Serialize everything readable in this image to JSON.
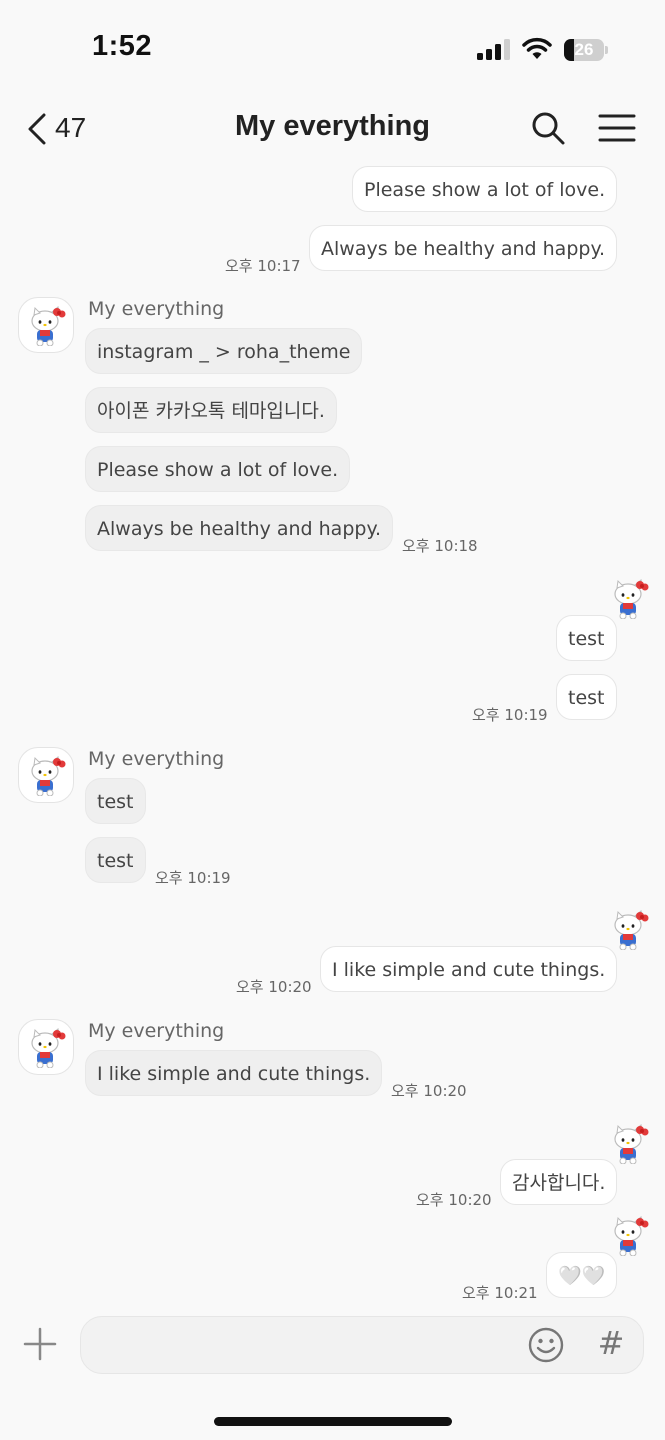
{
  "status_bar": {
    "time": "1:52",
    "battery": "26",
    "icons": [
      "cellular-signal-icon",
      "wifi-icon",
      "battery-icon"
    ]
  },
  "header": {
    "back_count": "47",
    "title": "My everything",
    "icons": [
      "chevron-left-icon",
      "search-icon",
      "menu-icon"
    ]
  },
  "messages": [
    {
      "from": "me",
      "text": "Please show a lot of love."
    },
    {
      "from": "me",
      "text": "Always be healthy and happy.",
      "time": "오후 10:17"
    },
    {
      "from": "them",
      "sender": "My everything",
      "text": "instagram _ > roha_theme"
    },
    {
      "from": "them",
      "text": "아이폰 카카오톡 테마입니다."
    },
    {
      "from": "them",
      "text": "Please show a lot of love."
    },
    {
      "from": "them",
      "text": "Always be healthy and happy.",
      "time": "오후 10:18"
    },
    {
      "from": "me",
      "text": "test"
    },
    {
      "from": "me",
      "text": "test",
      "time": "오후 10:19"
    },
    {
      "from": "them",
      "sender": "My everything",
      "text": "test"
    },
    {
      "from": "them",
      "text": "test",
      "time": "오후 10:19"
    },
    {
      "from": "me",
      "text": "I like simple and cute things.",
      "time": "오후 10:20"
    },
    {
      "from": "them",
      "sender": "My everything",
      "text": "I like simple and cute things.",
      "time": "오후 10:20"
    },
    {
      "from": "me",
      "text": "감사합니다.",
      "time": "오후 10:20"
    },
    {
      "from": "me",
      "text": "🤍🤍",
      "time": "오후 10:21"
    }
  ],
  "input_bar": {
    "placeholder": "",
    "hash_label": "#",
    "icons": [
      "plus-icon",
      "smiley-icon",
      "hash-icon"
    ]
  },
  "avatar_icon": "hello-kitty-avatar-icon"
}
